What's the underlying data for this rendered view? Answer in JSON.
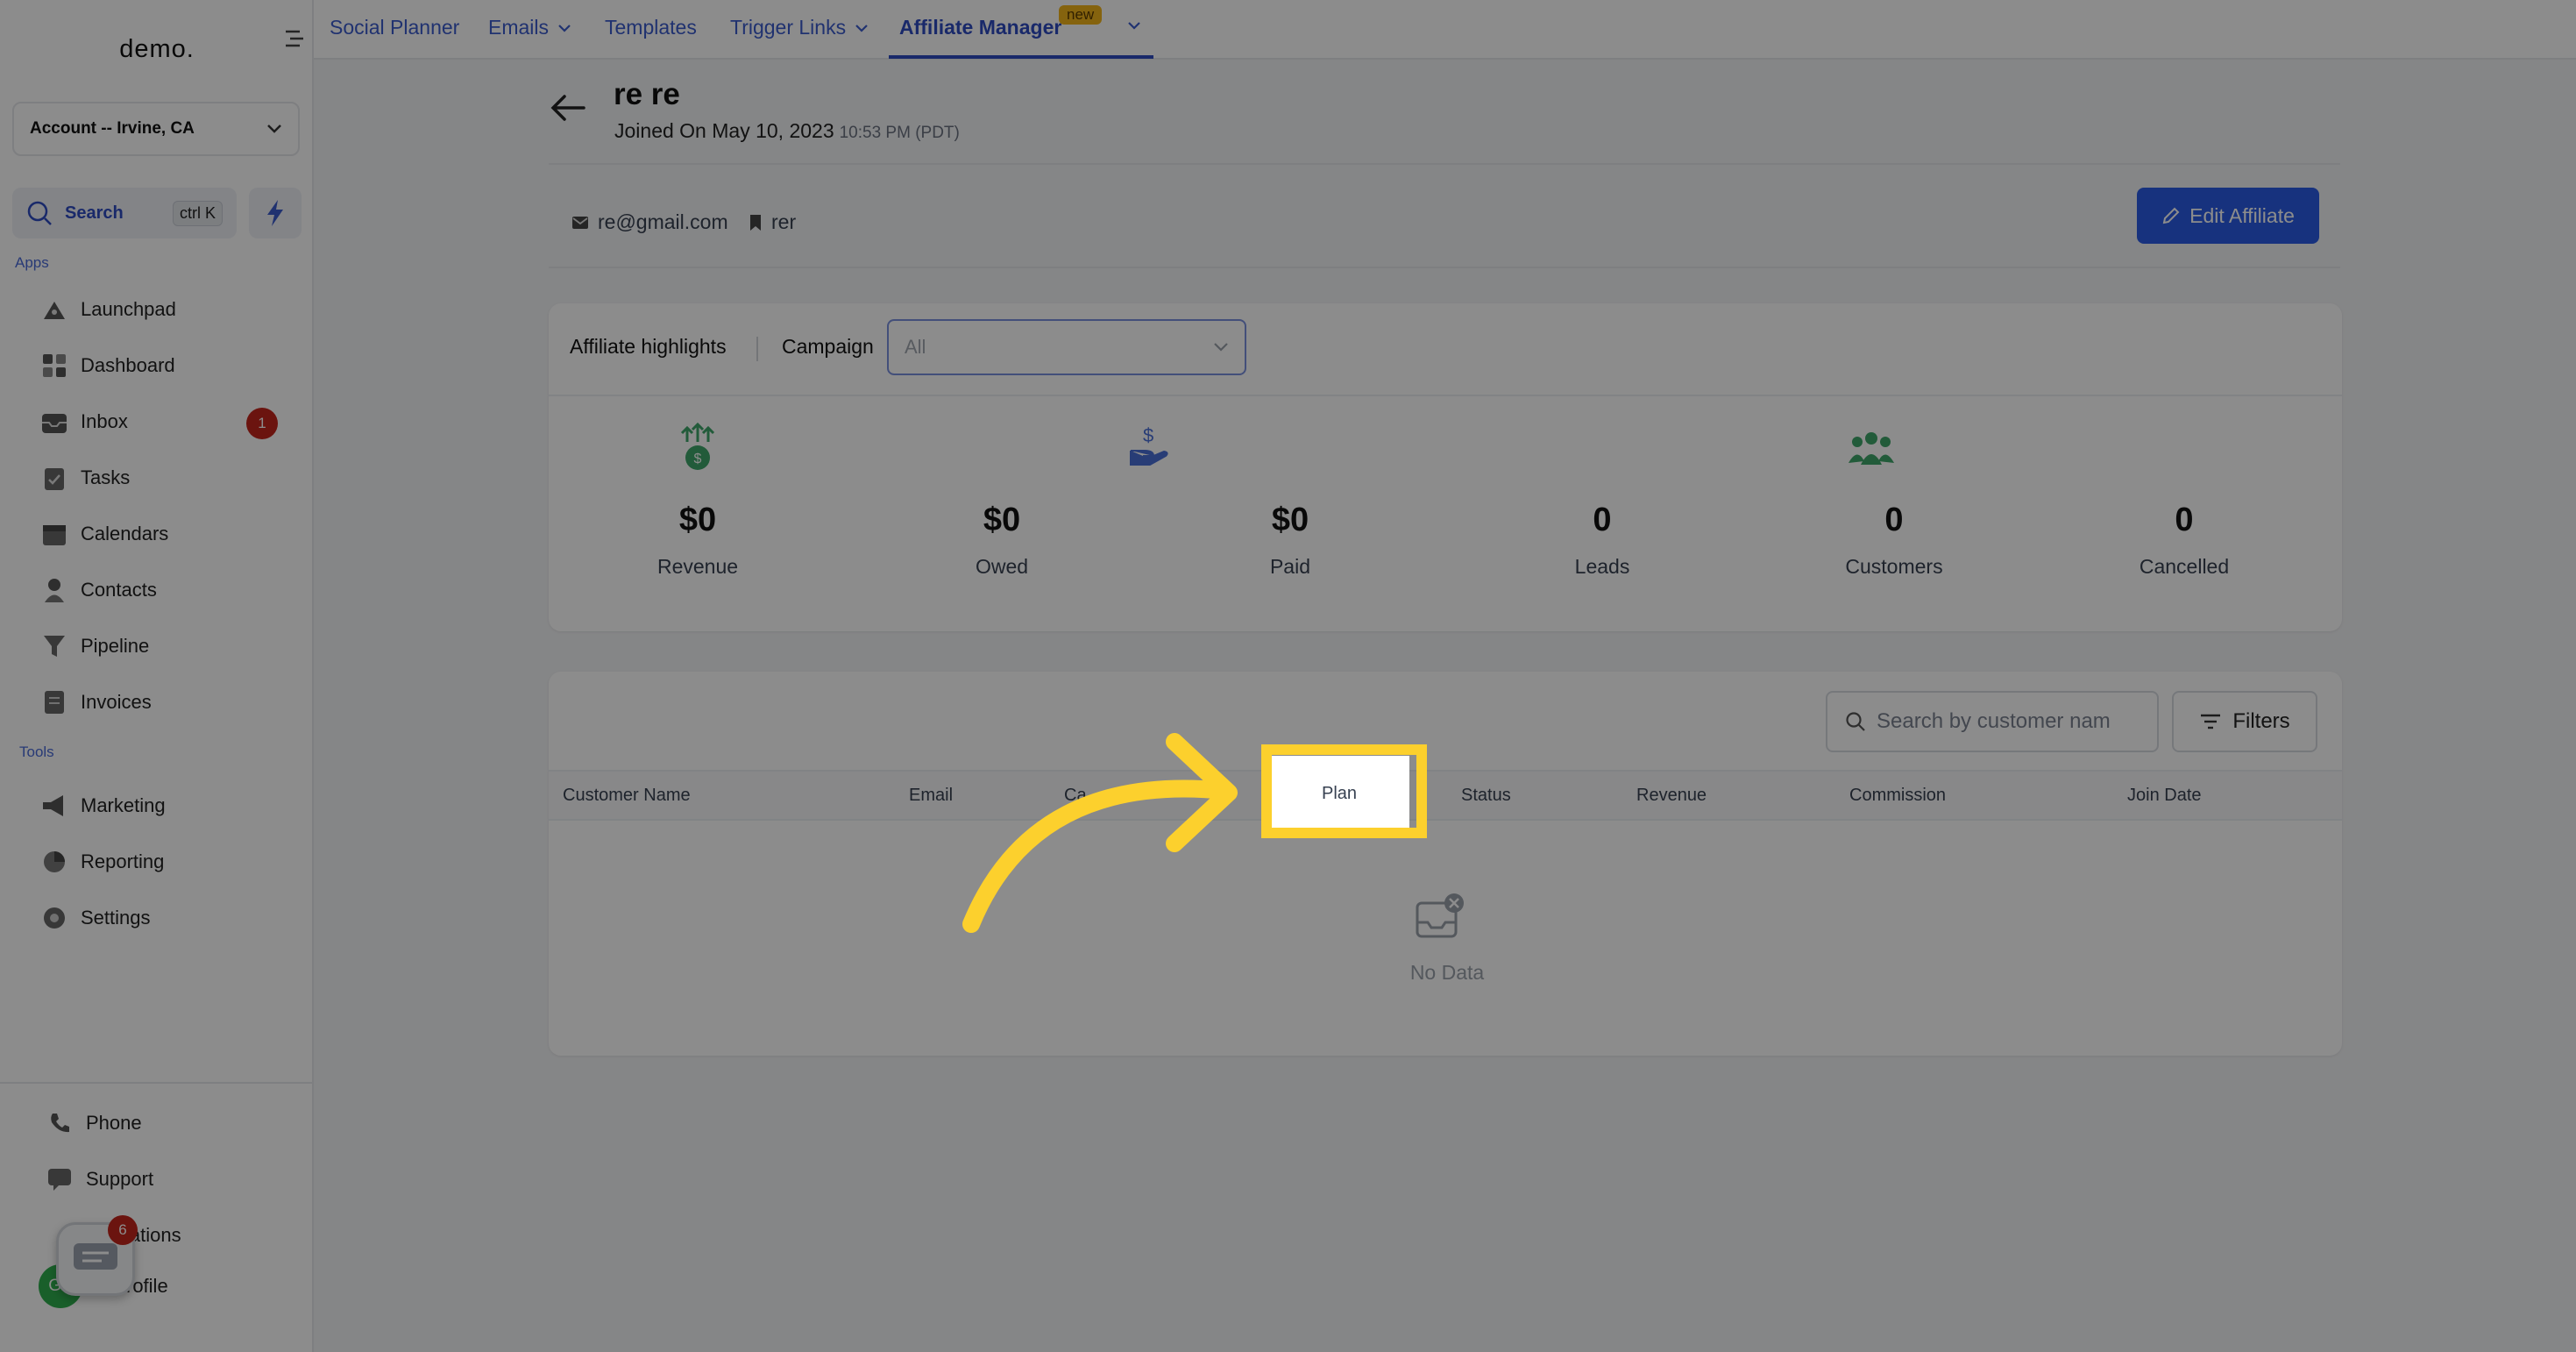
{
  "sidebar": {
    "logo": "demo.",
    "account": "Account -- Irvine, CA",
    "search_label": "Search",
    "search_shortcut": "ctrl K",
    "apps_heading": "Apps",
    "tools_heading": "Tools",
    "apps": [
      {
        "label": "Launchpad",
        "icon": "rocket-icon"
      },
      {
        "label": "Dashboard",
        "icon": "grid-icon"
      },
      {
        "label": "Inbox",
        "icon": "inbox-icon",
        "badge": "1"
      },
      {
        "label": "Tasks",
        "icon": "clipboard-icon"
      },
      {
        "label": "Calendars",
        "icon": "calendar-icon"
      },
      {
        "label": "Contacts",
        "icon": "person-icon"
      },
      {
        "label": "Pipeline",
        "icon": "funnel-icon"
      },
      {
        "label": "Invoices",
        "icon": "invoice-icon"
      }
    ],
    "tools": [
      {
        "label": "Marketing",
        "icon": "megaphone-icon"
      },
      {
        "label": "Reporting",
        "icon": "pie-chart-icon"
      },
      {
        "label": "Settings",
        "icon": "gear-icon"
      }
    ],
    "bottom": [
      {
        "label": "Phone",
        "icon": "phone-icon"
      },
      {
        "label": "Support",
        "icon": "chat-icon"
      },
      {
        "label": "ications",
        "icon": "bell-icon"
      },
      {
        "label": "rofile",
        "icon": "avatar"
      }
    ],
    "chat_badge": "6",
    "avatar_initials": "GP"
  },
  "topbar": {
    "tabs": [
      "Social Planner",
      "Emails",
      "Templates",
      "Trigger Links",
      "Affiliate Manager"
    ],
    "new_pill": "new"
  },
  "affiliate": {
    "name": "re re",
    "joined": "Joined On May 10, 2023",
    "joined_time": "10:53 PM (PDT)",
    "email": "re@gmail.com",
    "code": "rer",
    "edit_button": "Edit Affiliate"
  },
  "highlights": {
    "label": "Affiliate highlights",
    "campaign_label": "Campaign",
    "campaign_value": "All",
    "stats": [
      {
        "value": "$0",
        "label": "Revenue",
        "icon": "money-growth-icon"
      },
      {
        "value": "$0",
        "label": "Owed",
        "icon": ""
      },
      {
        "value": "$0",
        "label": "Paid",
        "icon": "hand-dollar-icon"
      },
      {
        "value": "0",
        "label": "Leads",
        "icon": ""
      },
      {
        "value": "0",
        "label": "Customers",
        "icon": "people-group-icon"
      },
      {
        "value": "0",
        "label": "Cancelled",
        "icon": ""
      }
    ]
  },
  "table": {
    "search_placeholder": "Search by customer nam",
    "filters_label": "Filters",
    "columns": [
      "Customer Name",
      "Email",
      "Ca",
      "Plan",
      "Status",
      "Revenue",
      "Commission",
      "Join Date"
    ],
    "empty_text": "No Data"
  },
  "highlight_target": "Plan",
  "colors": {
    "accent": "#2b5ce6",
    "highlight": "#fcd02d",
    "badge": "#c4261d"
  }
}
